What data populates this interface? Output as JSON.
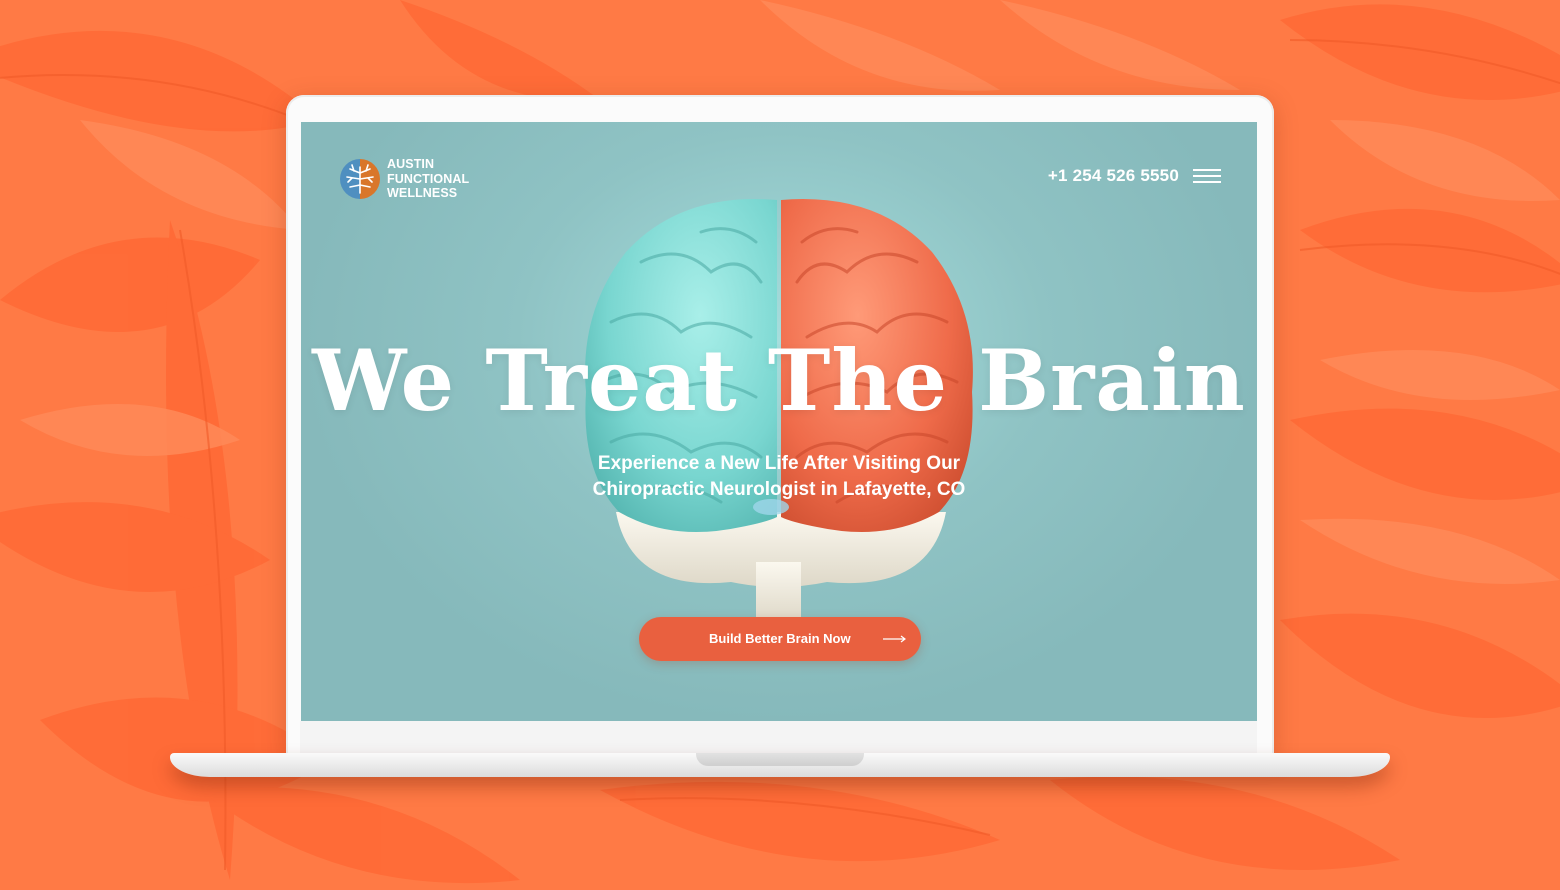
{
  "brand": {
    "line1": "AUSTIN",
    "line2": "FUNCTIONAL",
    "line3": "WELLNESS",
    "colors": {
      "blue": "#4f8fc0",
      "orange": "#d9762a"
    }
  },
  "header": {
    "phone": "+1 254 526 5550",
    "menu_icon": "hamburger-menu-icon"
  },
  "hero": {
    "title": "We Treat The Brain",
    "subtitle_line1": "Experience a New Life After Visiting Our",
    "subtitle_line2": "Chiropractic Neurologist in Lafayette, CO",
    "cta_label": "Build Better Brain Now",
    "cta_icon": "arrow-right-icon"
  },
  "colors": {
    "background": "#ff7a45",
    "screen": "#8fc3c4",
    "brain_left": "#79d6d0",
    "brain_right": "#ef6b4a",
    "cta": "#e9603f"
  }
}
